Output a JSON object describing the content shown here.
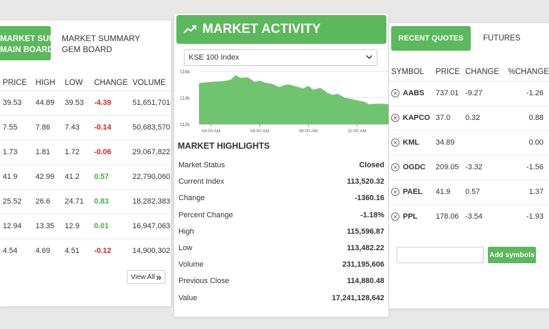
{
  "left_panel": {
    "tabs": {
      "active_line1": "MARKET SUMMARY",
      "active_line2": "MAIN BOARD",
      "inactive_line1": "MARKET SUMMARY",
      "inactive_line2": "GEM BOARD"
    },
    "columns": [
      "PRICE",
      "HIGH",
      "LOW",
      "CHANGE",
      "VOLUME"
    ],
    "rows": [
      {
        "price": "39.53",
        "high": "44.89",
        "low": "39.53",
        "change": "-4.39",
        "volume": "51,651,701",
        "dir": "neg"
      },
      {
        "price": "7.55",
        "high": "7.86",
        "low": "7.43",
        "change": "-0.14",
        "volume": "50,683,570",
        "dir": "neg"
      },
      {
        "price": "1.73",
        "high": "1.81",
        "low": "1.72",
        "change": "-0.06",
        "volume": "29,067,822",
        "dir": "neg"
      },
      {
        "price": "41.9",
        "high": "42.99",
        "low": "41.2",
        "change": "0.57",
        "volume": "22,790,060",
        "dir": "pos"
      },
      {
        "price": "25.52",
        "high": "26.6",
        "low": "24.71",
        "change": "0.83",
        "volume": "18,282,383",
        "dir": "pos"
      },
      {
        "price": "12.94",
        "high": "13.35",
        "low": "12.9",
        "change": "0.01",
        "volume": "16,947,063",
        "dir": "pos"
      },
      {
        "price": "4.54",
        "high": "4.69",
        "low": "4.51",
        "change": "-0.12",
        "volume": "14,900,302",
        "dir": "neg"
      }
    ],
    "view_all_label": "View All"
  },
  "center_panel": {
    "title": "MARKET ACTIVITY",
    "selected_index": "KSE 100 Index",
    "highlights_title": "MARKET HIGHLIGHTS",
    "highlights": [
      {
        "label": "Market Status",
        "value": "Closed"
      },
      {
        "label": "Current Index",
        "value": "113,520.32"
      },
      {
        "label": "Change",
        "value": "-1360.16"
      },
      {
        "label": "Percent Change",
        "value": "-1.18%"
      },
      {
        "label": "High",
        "value": "115,596.87"
      },
      {
        "label": "Low",
        "value": "113,482.22"
      },
      {
        "label": "Volume",
        "value": "231,195,606"
      },
      {
        "label": "Previous Close",
        "value": "114,880.48"
      },
      {
        "label": "Value",
        "value": "17,241,128,642"
      }
    ]
  },
  "chart_data": {
    "type": "area",
    "y_ticks": [
      "116k",
      "114k",
      "112k"
    ],
    "x_ticks": [
      "04:00 AM",
      "06:00 AM",
      "08:00 AM",
      "10:00 AM"
    ],
    "ylim": [
      112000,
      116000
    ],
    "xlim": [
      3.5,
      11.3
    ],
    "x": [
      3.5,
      4.0,
      4.5,
      4.8,
      5.0,
      5.2,
      5.5,
      5.8,
      6.0,
      6.2,
      6.5,
      6.8,
      7.0,
      7.2,
      7.5,
      7.8,
      8.0,
      8.2,
      8.5,
      8.8,
      9.0,
      9.2,
      9.5,
      9.8,
      10.0,
      10.3,
      10.5,
      10.8,
      11.0,
      11.3
    ],
    "y": [
      115100,
      115200,
      115250,
      115350,
      115700,
      115500,
      115550,
      115200,
      115300,
      115150,
      115050,
      114800,
      114950,
      115000,
      114850,
      114700,
      114900,
      114600,
      114750,
      114350,
      114200,
      114300,
      114000,
      113900,
      113800,
      113700,
      113500,
      113550,
      113550,
      113500
    ],
    "color": "#70c470"
  },
  "right_panel": {
    "tabs": {
      "active": "RECENT QUOTES",
      "inactive": "FUTURES"
    },
    "columns": [
      "SYMBOL",
      "PRICE",
      "CHANGE",
      "%CHANGE"
    ],
    "rows": [
      {
        "symbol": "AABS",
        "price": "737.01",
        "change": "-9.27",
        "pchange": "-1.26"
      },
      {
        "symbol": "KAPCO",
        "price": "37.0",
        "change": "0.32",
        "pchange": "0.88"
      },
      {
        "symbol": "KML",
        "price": "34.89",
        "change": "",
        "pchange": "0.00"
      },
      {
        "symbol": "OGDC",
        "price": "209.05",
        "change": "-3.32",
        "pchange": "-1.56"
      },
      {
        "symbol": "PAEL",
        "price": "41.9",
        "change": "0.57",
        "pchange": "1.37"
      },
      {
        "symbol": "PPL",
        "price": "178.06",
        "change": "-3.54",
        "pchange": "-1.93"
      }
    ],
    "symbol_input_placeholder": "",
    "add_button_label": "Add symbols"
  },
  "colors": {
    "accent": "#5cb85c",
    "negative": "#e02020",
    "positive": "#3cb33c"
  }
}
